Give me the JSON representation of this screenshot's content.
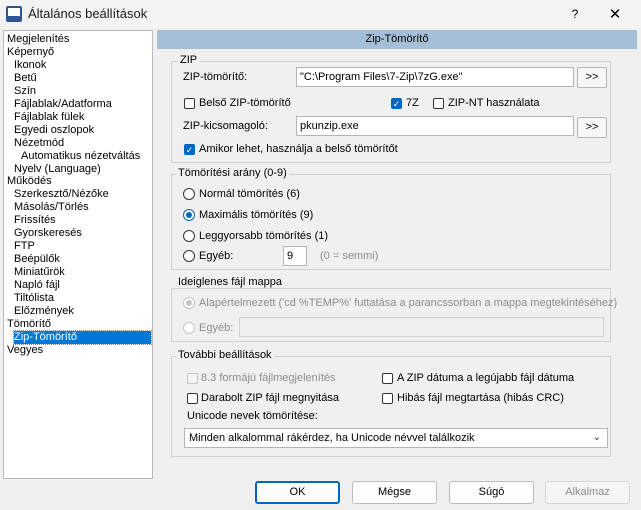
{
  "window": {
    "title": "Általános beállítások",
    "help_glyph": "?",
    "close_glyph": "✕"
  },
  "tree": {
    "items": [
      {
        "label": "Megjelenítés"
      },
      {
        "label": "Képernyő"
      },
      {
        "label": "Ikonok"
      },
      {
        "label": "Betű"
      },
      {
        "label": "Szín"
      },
      {
        "label": "Fájlablak/Adatforma"
      },
      {
        "label": "Fájlablak fülek"
      },
      {
        "label": "Egyedi oszlopok"
      },
      {
        "label": "Nézetmód"
      },
      {
        "label": "Automatikus nézetváltás"
      },
      {
        "label": "Nyelv (Language)"
      },
      {
        "label": "Működés"
      },
      {
        "label": "Szerkesztő/Nézőke"
      },
      {
        "label": "Másolás/Törlés"
      },
      {
        "label": "Frissítés"
      },
      {
        "label": "Gyorskeresés"
      },
      {
        "label": "FTP"
      },
      {
        "label": "Beépülők"
      },
      {
        "label": "Miniatűrök"
      },
      {
        "label": "Napló fájl"
      },
      {
        "label": "Tiltólista"
      },
      {
        "label": "Előzmények"
      },
      {
        "label": "Tömörítő"
      },
      {
        "label": "Zip-Tömörítő"
      },
      {
        "label": "Vegyes"
      }
    ],
    "selected": "Zip-Tömörítő"
  },
  "panel": {
    "title": "Zip-Tömörítő"
  },
  "zip": {
    "group_title": "ZIP",
    "packer_label": "ZIP-tömörítő:",
    "packer_value": "\"C:\\Program Files\\7-Zip\\7zG.exe\"",
    "browse_label": ">>",
    "internal_label": "Belső ZIP-tömörítő",
    "internal_checked": false,
    "sevenz_label": "7Z",
    "sevenz_checked": true,
    "zipnt_label": "ZIP-NT használata",
    "zipnt_checked": false,
    "unpacker_label": "ZIP-kicsomagoló:",
    "unpacker_value": "pkunzip.exe",
    "browse2_label": ">>",
    "use_internal_label": "Amikor lehet, használja a belső tömörítőt",
    "use_internal_checked": true
  },
  "ratio": {
    "group_title": "Tömörítési arány (0-9)",
    "options": [
      {
        "label": "Normál tömörítés (6)",
        "checked": false
      },
      {
        "label": "Maximális tömörítés (9)",
        "checked": true
      },
      {
        "label": "Leggyorsabb tömörítés (1)",
        "checked": false
      },
      {
        "label": "Egyéb:",
        "checked": false
      }
    ],
    "other_value": "9",
    "other_hint": "(0 = semmi)"
  },
  "temp": {
    "group_title": "Ideiglenes fájl mappa",
    "default_label": "Alapértelmezett ('cd %TEMP%' futtatása a parancssorban a mappa megtekintéséhez)",
    "other_label": "Egyéb:"
  },
  "more": {
    "group_title": "További beállítások",
    "opt_83_label": "8.3 formájú fájlmegjelenítés",
    "opt_date_label": "A ZIP dátuma a legújabb fájl dátuma",
    "opt_broken_label": "Darabolt ZIP fájl megnyitása",
    "opt_crc_label": "Hibás fájl megtartása (hibás CRC)",
    "unicode_label": "Unicode nevek tömörítése:",
    "unicode_value": "Minden alkalommal rákérdez, ha Unicode névvel találkozik",
    "chevron": "⌄"
  },
  "buttons": {
    "ok": "OK",
    "cancel": "Mégse",
    "help": "Súgó",
    "apply": "Alkalmaz"
  },
  "colors": {
    "accent": "#0067c0",
    "header_bg": "#a6bfd8",
    "selection": "#0078d7"
  }
}
